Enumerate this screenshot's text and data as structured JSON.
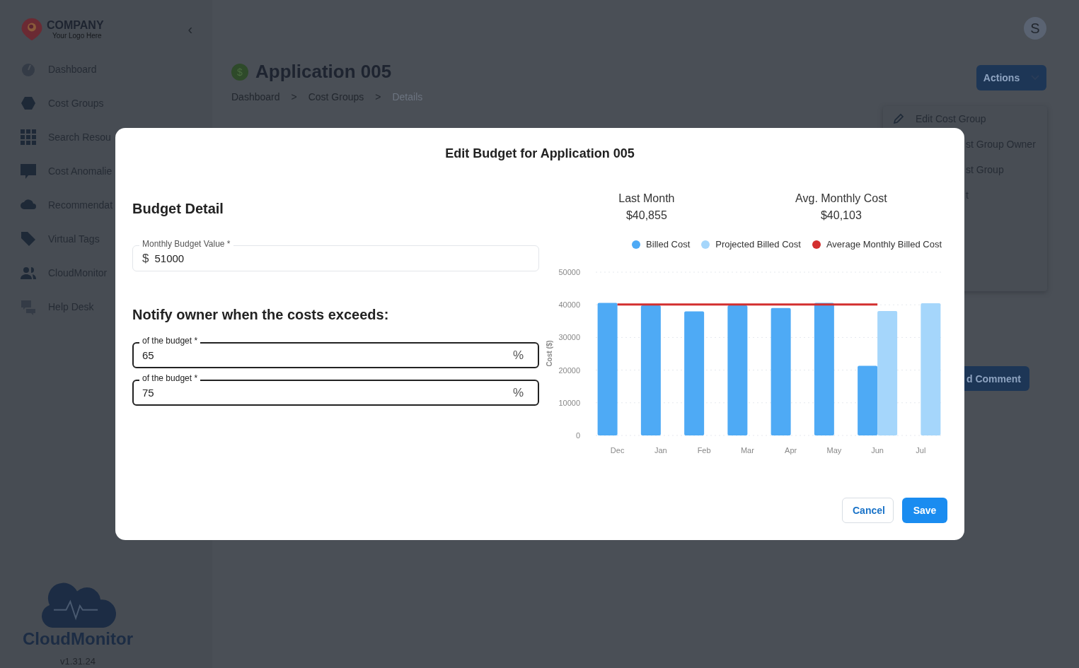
{
  "logo": {
    "name": "COMPANY",
    "tagline": "Your Logo Here"
  },
  "collapse": "‹",
  "sidebar": {
    "items": [
      {
        "label": "Dashboard"
      },
      {
        "label": "Cost Groups"
      },
      {
        "label": "Search Resou"
      },
      {
        "label": "Cost Anomalie"
      },
      {
        "label": "Recommendat"
      },
      {
        "label": "Virtual Tags"
      },
      {
        "label": "CloudMonitor"
      },
      {
        "label": "Help Desk"
      }
    ],
    "brand": "CloudMonitor",
    "version": "v1.31.24"
  },
  "avatar": "S",
  "page": {
    "title": "Application 005",
    "icon": "$",
    "breadcrumbs": [
      {
        "label": "Dashboard",
        "current": false
      },
      {
        "label": "Cost Groups",
        "current": false
      },
      {
        "label": "Details",
        "current": true
      }
    ],
    "separator": ">"
  },
  "actions": {
    "label": "Actions",
    "menu": [
      {
        "label": "Edit Cost Group",
        "kind": "full"
      },
      {
        "label": "st Group Owner",
        "kind": "partial"
      },
      {
        "label": "st Group",
        "kind": "partial"
      },
      {
        "label": "t",
        "kind": "partial"
      }
    ]
  },
  "comment_button": "d Comment",
  "modal": {
    "title": "Edit Budget for Application 005",
    "section": "Budget Detail",
    "budget_field": {
      "label": "Monthly Budget Value *",
      "prefix": "$",
      "value": "51000"
    },
    "notify_heading": "Notify owner when the costs exceeds:",
    "thresholds": [
      {
        "label": "of the budget *",
        "value": "65",
        "suffix": "%"
      },
      {
        "label": "of the budget *",
        "value": "75",
        "suffix": "%"
      }
    ],
    "stats": [
      {
        "label": "Last Month",
        "value": "$40,855"
      },
      {
        "label": "Avg. Monthly Cost",
        "value": "$40,103"
      }
    ],
    "chart_data": {
      "type": "bar",
      "ylabel": "Cost ($)",
      "categories": [
        "Dec",
        "Jan",
        "Feb",
        "Mar",
        "Apr",
        "May",
        "Jun",
        "Jul"
      ],
      "series": [
        {
          "name": "Billed Cost",
          "color": "#4eaaf5",
          "values": [
            40600,
            39800,
            38000,
            39800,
            39000,
            40600,
            21300,
            null
          ]
        },
        {
          "name": "Projected Billed Cost",
          "color": "#a5d6fb",
          "values": [
            null,
            null,
            null,
            null,
            null,
            null,
            38100,
            40500
          ]
        },
        {
          "name": "Average Monthly Billed Cost",
          "color": "#d32f2f",
          "type": "line",
          "values": [
            40100,
            40100,
            40100,
            40100,
            40100,
            40100,
            40100,
            null
          ]
        }
      ],
      "ylim": [
        0,
        50000
      ],
      "grid": true,
      "yticks": [
        0,
        10000,
        20000,
        30000,
        40000,
        50000
      ]
    },
    "buttons": [
      {
        "label": "Cancel",
        "kind": "secondary"
      },
      {
        "label": "Save",
        "kind": "primary"
      }
    ]
  }
}
